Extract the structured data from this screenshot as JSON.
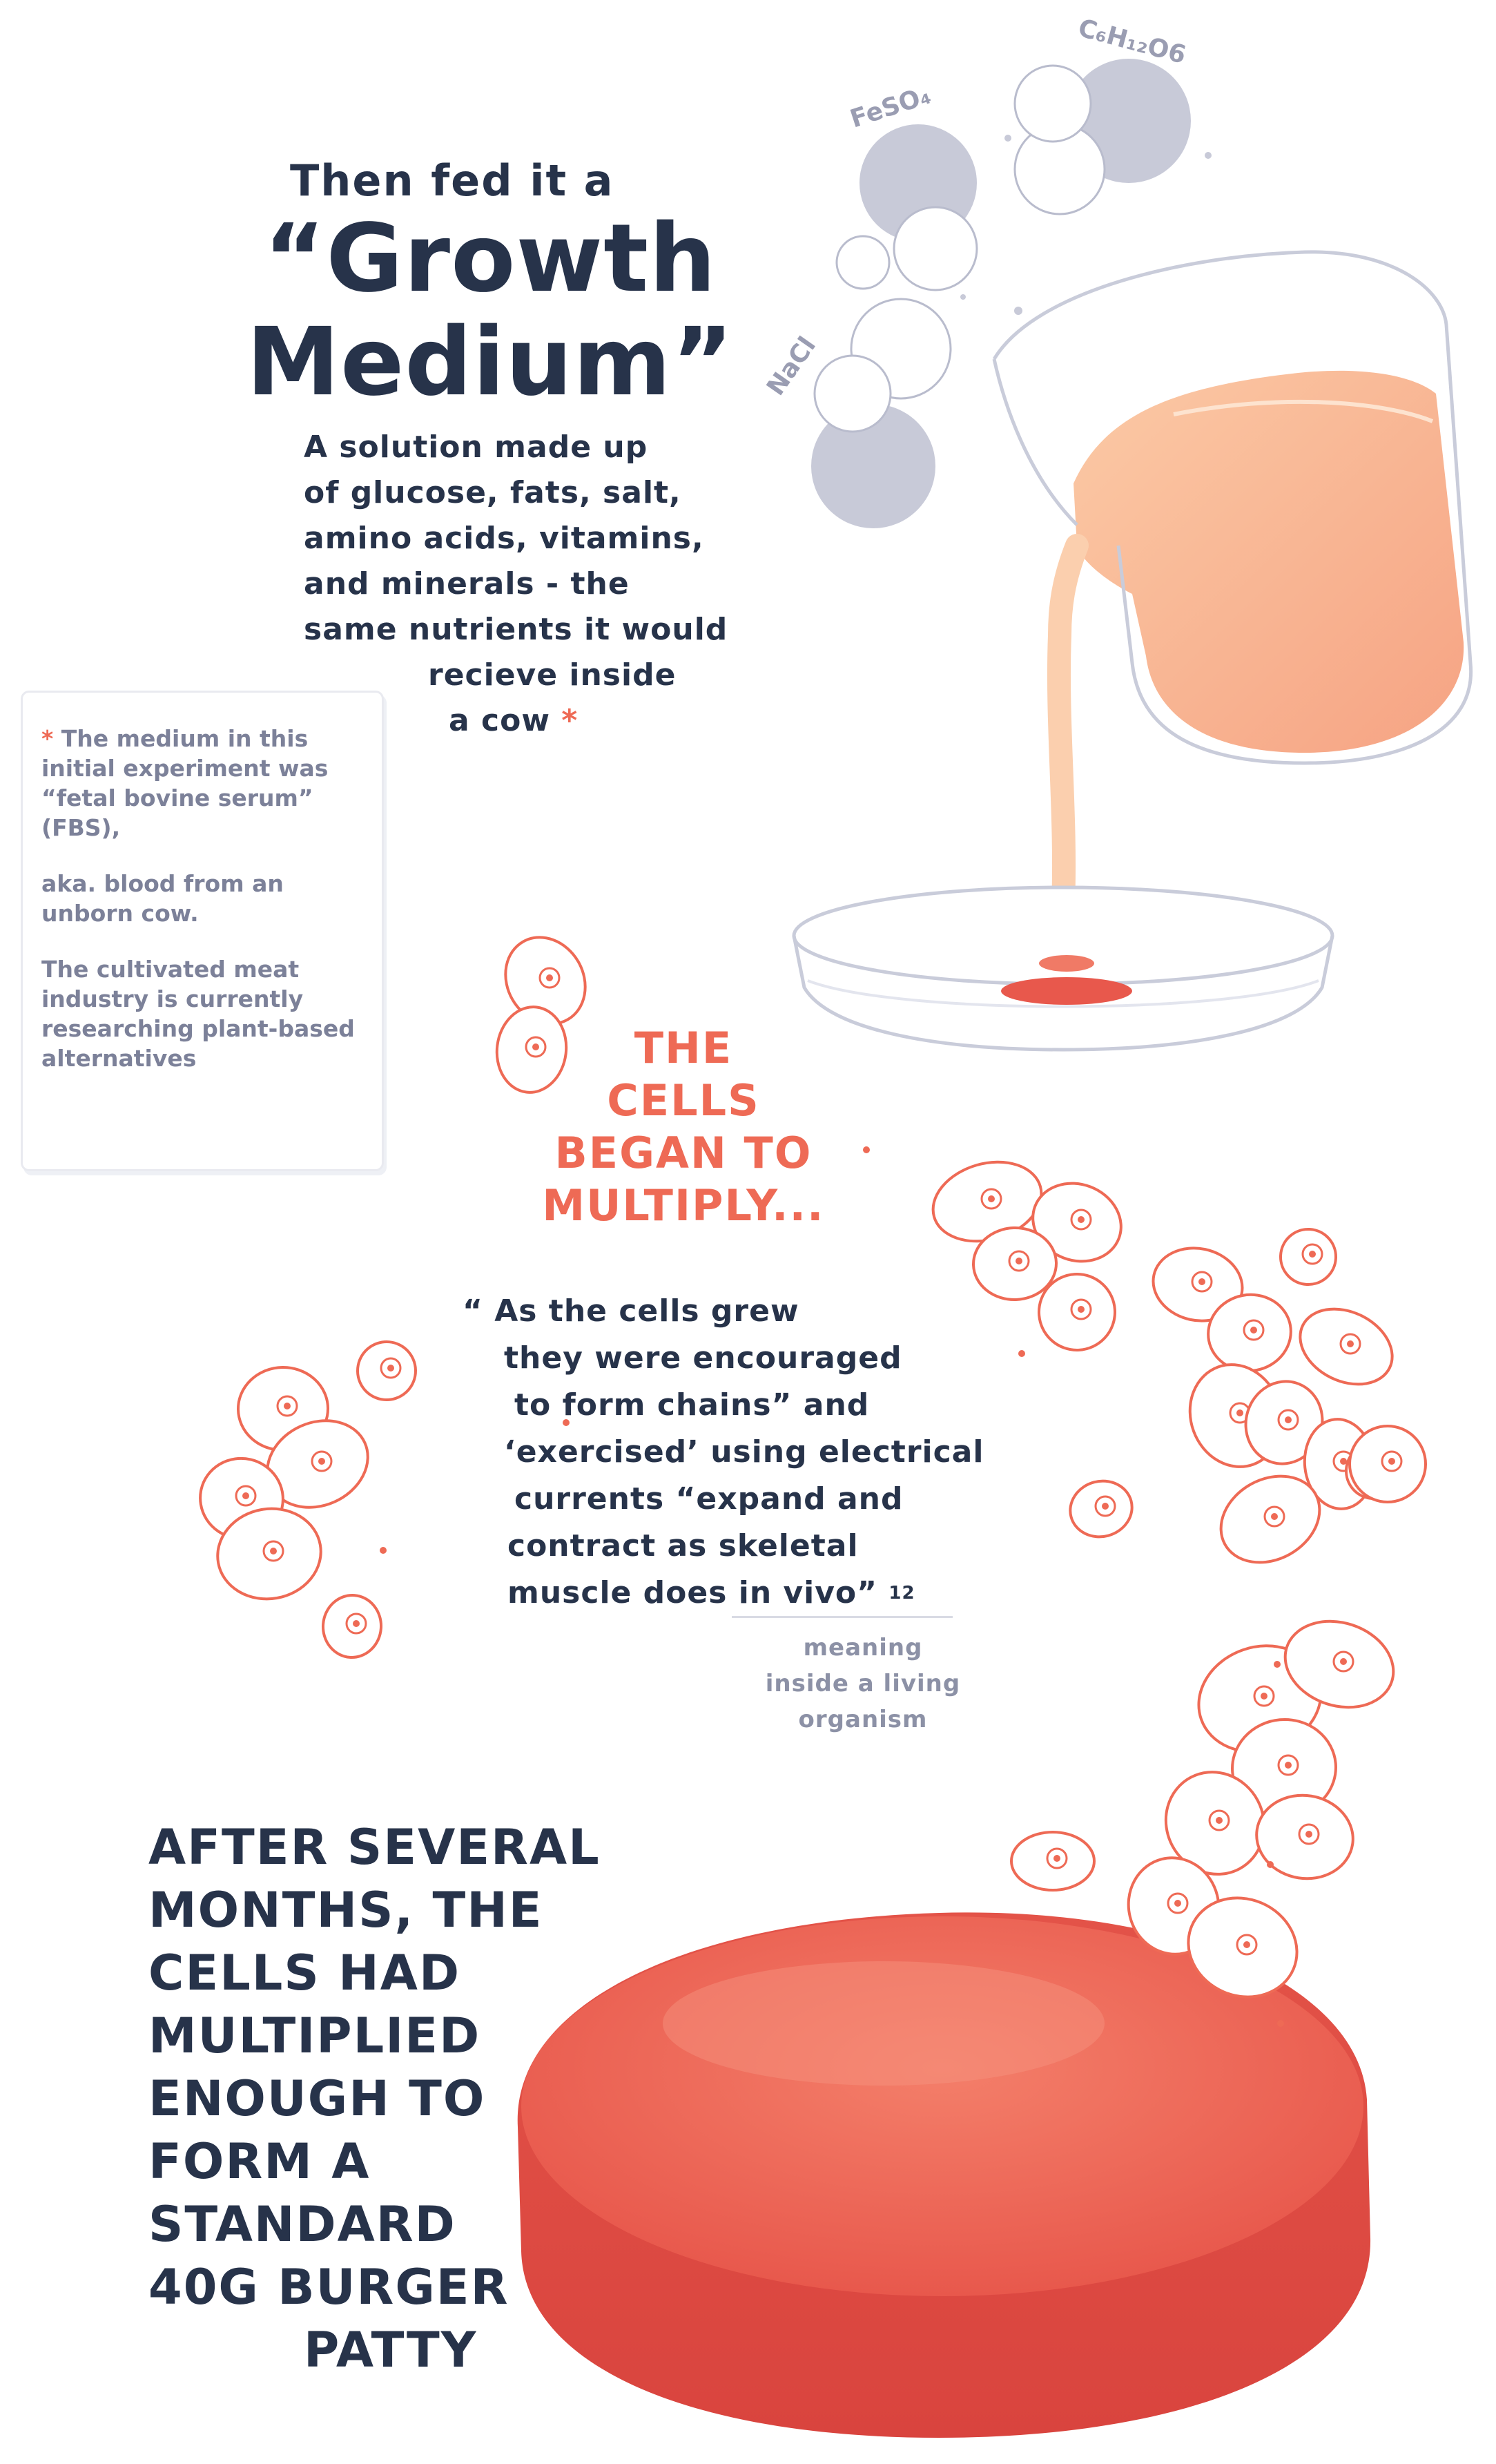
{
  "header": {
    "intro": "Then fed it a",
    "title_line1": "“Growth",
    "title_line2": "Medium”"
  },
  "description": {
    "lines": [
      "A solution made up",
      "of glucose, fats, salt,",
      "amino acids, vitamins,",
      "and minerals - the",
      "same nutrients it would",
      "recieve inside",
      "a cow"
    ],
    "asterisk": "*"
  },
  "molecules": {
    "feso4": "FeSO₄",
    "glucose": "C₆H₁₂O6",
    "nacl": "NaCl"
  },
  "footnote": {
    "asterisk": "*",
    "p1": "The medium in this initial experiment was “fetal bovine serum” (FBS),",
    "p2": "aka. blood from an unborn cow.",
    "p3": "The cultivated meat industry is currently researching plant-based alternatives"
  },
  "multiply": {
    "lines": [
      "The",
      "cells",
      "began to",
      "multiply..."
    ]
  },
  "quote": {
    "lines": [
      "“ As the cells grew",
      "they were encouraged",
      "to form chains” and",
      "‘exercised’ using electrical",
      "currents “expand and",
      "contract as skeletal",
      "muscle does in vivo”"
    ],
    "ref": "12"
  },
  "meaning": {
    "lines": [
      "meaning",
      "inside a living",
      "organism"
    ]
  },
  "final": {
    "lines": [
      "After several",
      "months, the",
      "cells had",
      "multiplied",
      "enough to",
      "form a",
      "standard",
      "40g burger",
      "patty"
    ]
  },
  "colors": {
    "navy": "#27334a",
    "coral": "#ee6a55",
    "grey": "#8c91a6",
    "medium": "#f7b28f",
    "patty": "#ea5a4a"
  }
}
